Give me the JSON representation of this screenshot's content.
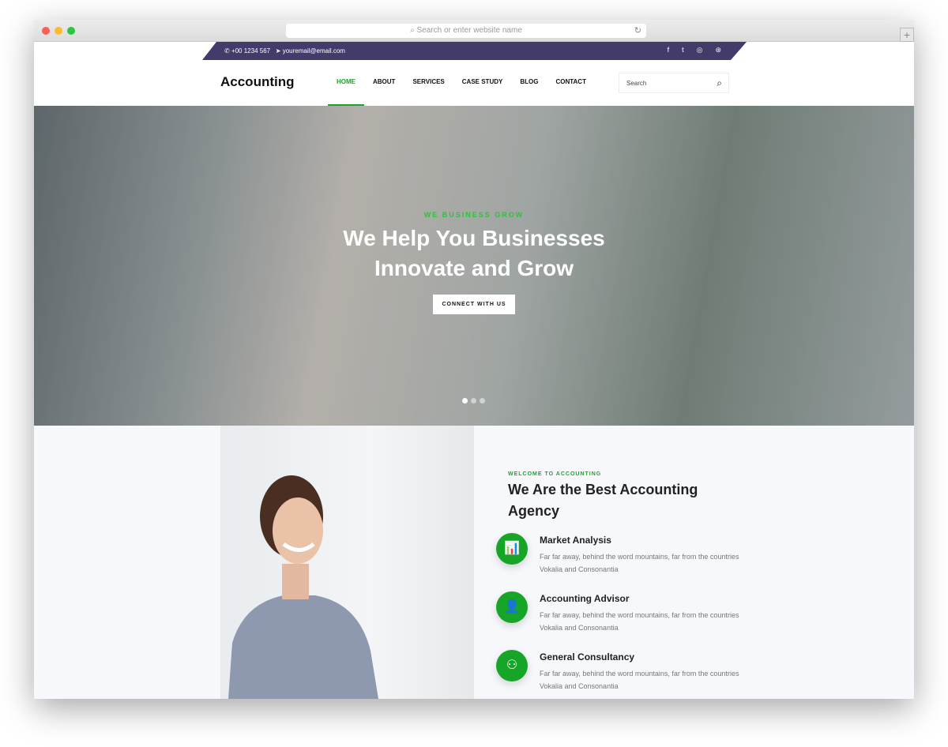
{
  "browser": {
    "url_placeholder": "Search or enter website name",
    "colors": {
      "close": "#fc5f57",
      "min": "#fdbc2e",
      "max": "#28c840"
    }
  },
  "topbar": {
    "phone": "+00 1234 567",
    "email": "youremail@email.com",
    "social": [
      "facebook-icon",
      "twitter-icon",
      "instagram-icon",
      "dribbble-icon"
    ],
    "color": "#433c6b"
  },
  "nav": {
    "logo": "Accounting",
    "items": [
      "HOME",
      "ABOUT",
      "SERVICES",
      "CASE STUDY",
      "BLOG",
      "CONTACT"
    ],
    "active": "HOME",
    "search_placeholder": "Search",
    "accent": "#1aa52a"
  },
  "hero": {
    "kicker": "WE BUSINESS GROW",
    "title_line1": "We Help You Businesses",
    "title_line2": "Innovate and Grow",
    "button": "CONNECT WITH US",
    "slides": 3,
    "active_slide": 1
  },
  "about": {
    "kicker": "WELCOME TO ACCOUNTING",
    "title": "We Are the Best Accounting Agency",
    "features": [
      {
        "icon": "market-analysis-icon",
        "title": "Market Analysis",
        "desc": "Far far away, behind the word mountains, far from the countries Vokalia and Consonantia"
      },
      {
        "icon": "accounting-advisor-icon",
        "title": "Accounting Advisor",
        "desc": "Far far away, behind the word mountains, far from the countries Vokalia and Consonantia"
      },
      {
        "icon": "consultancy-icon",
        "title": "General Consultancy",
        "desc": "Far far away, behind the word mountains, far from the countries Vokalia and Consonantia"
      }
    ]
  }
}
